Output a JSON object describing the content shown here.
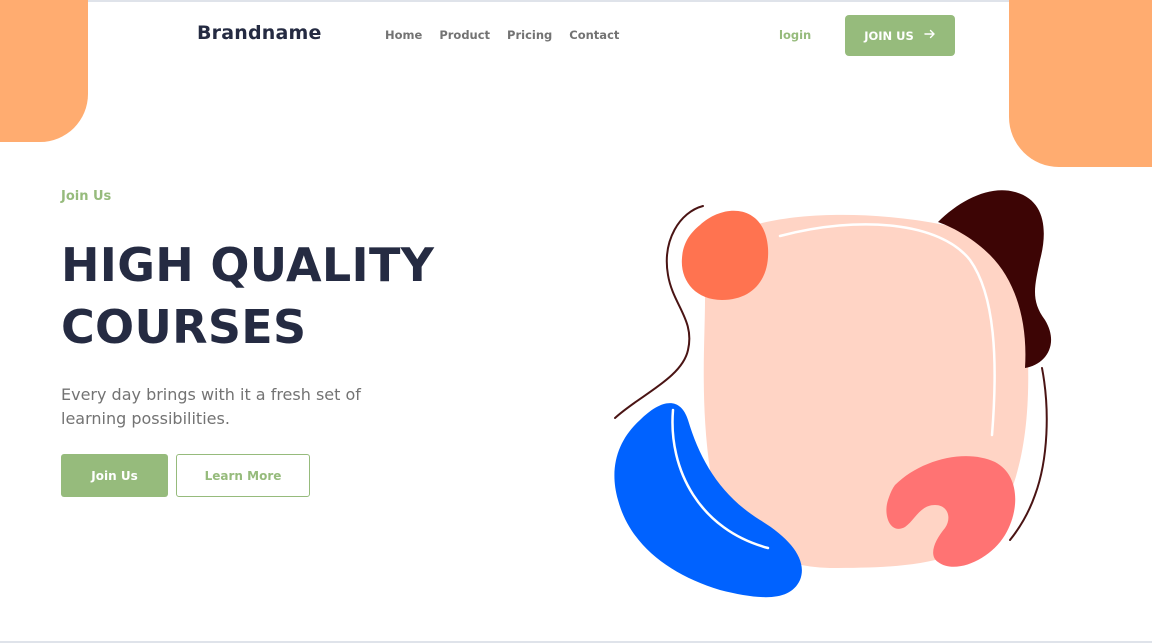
{
  "header": {
    "brand": "Brandname",
    "nav": [
      "Home",
      "Product",
      "Pricing",
      "Contact"
    ],
    "login_label": "login",
    "join_label": "JOIN US",
    "join_icon": "arrow-right-icon"
  },
  "hero": {
    "eyebrow": "Join Us",
    "headline_line1": "HIGH QUALITY",
    "headline_line2": "COURSES",
    "subtext": "Every day brings with it a fresh set of learning possibilities.",
    "primary_button": "Join Us",
    "secondary_button": "Learn More"
  },
  "colors": {
    "accent": "#96bb7c",
    "dark": "#252b42",
    "muted": "#737373",
    "orange_corner": "#ffac70",
    "blob_pink": "#ffd4c5",
    "blob_orange": "#ff7350",
    "blob_maroon": "#3d0505",
    "blob_blue": "#0062ff",
    "blob_coral": "#ff7373"
  }
}
